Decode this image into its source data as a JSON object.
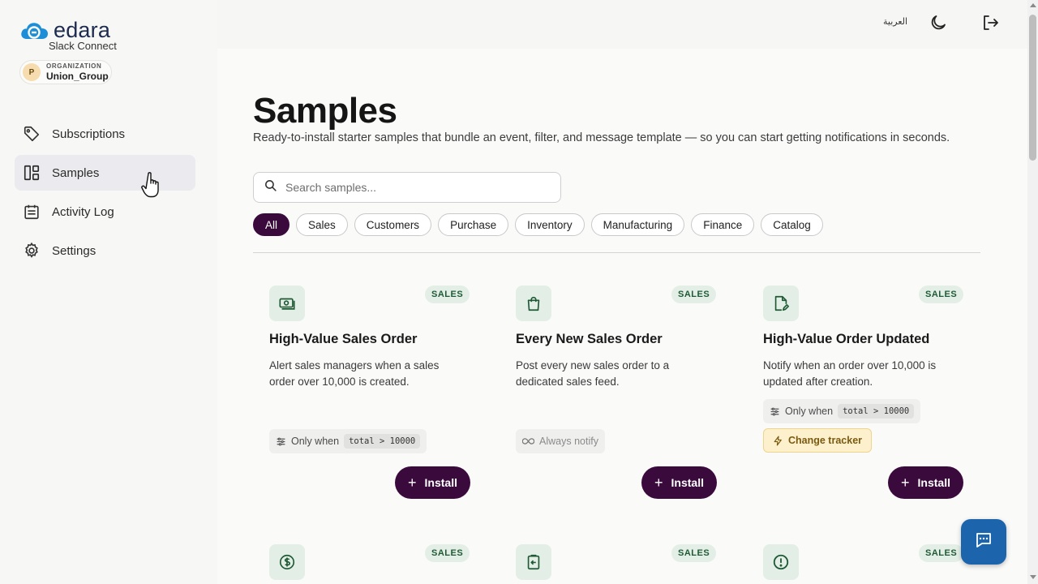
{
  "brand": {
    "name": "edara",
    "subtitle": "Slack Connect",
    "accent": "#3b0a3d",
    "logo_color": "#1d8fd8"
  },
  "organization": {
    "label": "ORGANIZATION",
    "avatar": "P",
    "name": "Union_Group"
  },
  "sidebar": {
    "items": [
      {
        "label": "Subscriptions",
        "icon": "tag-icon",
        "active": false
      },
      {
        "label": "Samples",
        "icon": "dashboard-icon",
        "active": true
      },
      {
        "label": "Activity Log",
        "icon": "calendar-list-icon",
        "active": false
      },
      {
        "label": "Settings",
        "icon": "gear-icon",
        "active": false
      }
    ]
  },
  "topbar": {
    "language": "العربية",
    "theme_icon": "moon-icon",
    "logout_icon": "logout-icon"
  },
  "page": {
    "title": "Samples",
    "description": "Ready-to-install starter samples that bundle an event, filter, and message template — so you can start getting notifications in seconds."
  },
  "search": {
    "placeholder": "Search samples..."
  },
  "filters": [
    "All",
    "Sales",
    "Customers",
    "Purchase",
    "Inventory",
    "Manufacturing",
    "Finance",
    "Catalog"
  ],
  "active_filter": "All",
  "cards": [
    {
      "badge": "SALES",
      "icon": "money-icon",
      "title": "High-Value Sales Order",
      "description": "Alert sales managers when a sales order over 10,000 is created.",
      "condition_label": "Only when",
      "condition_code": "total > 10000",
      "install_label": "Install"
    },
    {
      "badge": "SALES",
      "icon": "shopping-bag-icon",
      "title": "Every New Sales Order",
      "description": "Post every new sales order to a dedicated sales feed.",
      "condition_label": "Always notify",
      "install_label": "Install"
    },
    {
      "badge": "SALES",
      "icon": "document-edit-icon",
      "title": "High-Value Order Updated",
      "description": "Notify when an order over 10,000 is updated after creation.",
      "condition_label": "Only when",
      "condition_code": "total > 10000",
      "tracker_label": "Change tracker",
      "install_label": "Install"
    },
    {
      "badge": "SALES",
      "icon": "dollar-circle-icon"
    },
    {
      "badge": "SALES",
      "icon": "clipboard-return-icon"
    },
    {
      "badge": "SALES",
      "icon": "alert-circle-icon"
    }
  ],
  "chat": {
    "icon": "chat-icon"
  }
}
